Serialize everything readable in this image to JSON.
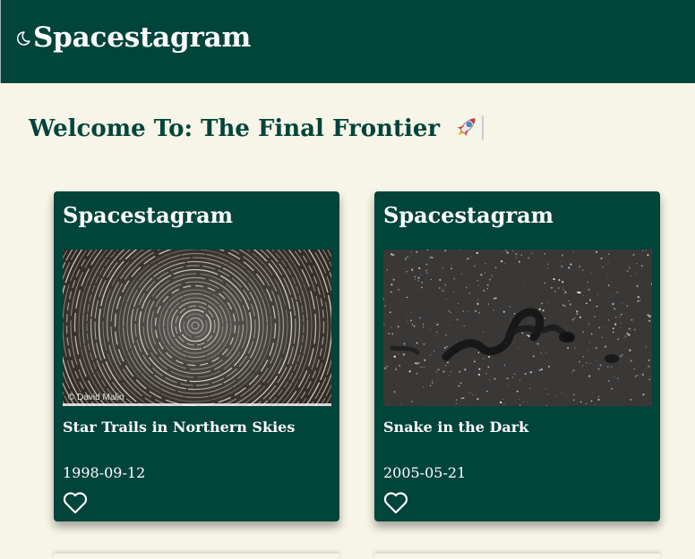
{
  "header": {
    "brand": "Spacestagram",
    "theme_icon": "moon-icon"
  },
  "welcome": {
    "text": "Welcome To: The Final Frontier",
    "emoji_icon": "rocket-icon"
  },
  "posts": [
    {
      "site_title": "Spacestagram",
      "image_watermark": "© David Malin",
      "title": "Star Trails in Northern Skies",
      "date": "1998-09-12",
      "like_icon": "heart-outline-icon"
    },
    {
      "site_title": "Spacestagram",
      "title": "Snake in the Dark",
      "date": "2005-05-21",
      "like_icon": "heart-outline-icon"
    }
  ],
  "colors": {
    "primary": "#00443a",
    "background": "#f7f5e8",
    "text_on_primary": "#ffffff"
  }
}
